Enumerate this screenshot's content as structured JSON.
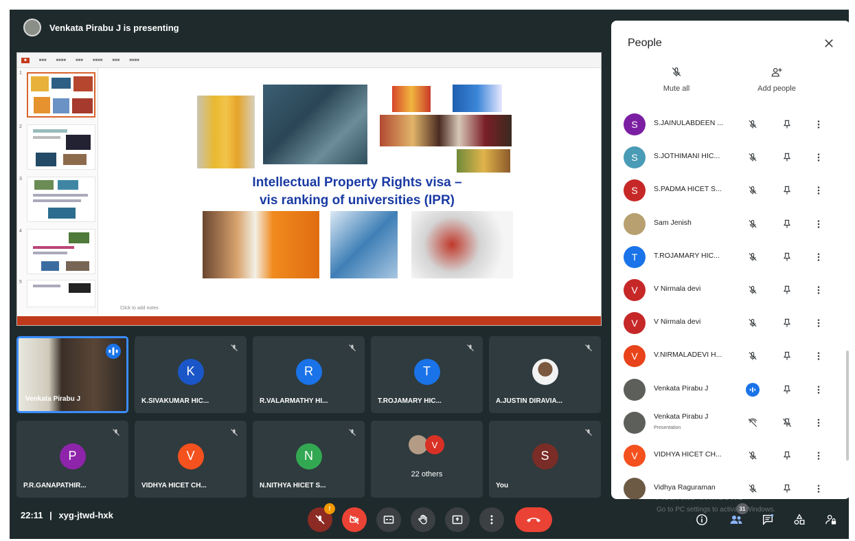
{
  "presenter": {
    "label": "Venkata Pirabu J is presenting"
  },
  "slide": {
    "title_line1": "Intellectual Property Rights visa –",
    "title_line2": "vis ranking of universities  (IPR)",
    "notes_placeholder": "Click to add notes"
  },
  "tiles": [
    {
      "name": "Venkata Pirabu J",
      "initial": "",
      "color": "#3b4a4d",
      "muted": false,
      "speaking": true
    },
    {
      "name": "K.SIVAKUMAR HIC...",
      "initial": "K",
      "color": "#1a56c8",
      "muted": true
    },
    {
      "name": "R.VALARMATHY HI...",
      "initial": "R",
      "color": "#1a73e8",
      "muted": true
    },
    {
      "name": "T.ROJAMARY HIC...",
      "initial": "T",
      "color": "#1a73e8",
      "muted": true
    },
    {
      "name": "A.JUSTIN DIRAVIA...",
      "initial": "",
      "color": "#cfcfcf",
      "muted": true
    },
    {
      "name": "P.R.GANAPATHIR...",
      "initial": "P",
      "color": "#8e24aa",
      "muted": true
    },
    {
      "name": "VIDHYA HICET CH...",
      "initial": "V",
      "color": "#f4511e",
      "muted": true
    },
    {
      "name": "N.NITHYA HICET S...",
      "initial": "N",
      "color": "#33a852",
      "muted": true
    },
    {
      "name": "22 others",
      "initial": "V",
      "color": "#d93025",
      "muted": false
    },
    {
      "name": "You",
      "initial": "S",
      "color": "#7a2c26",
      "muted": true
    }
  ],
  "meeting": {
    "time": "22:11",
    "separator": "|",
    "code": "xyg-jtwd-hxk"
  },
  "controls": {
    "mic_badge": "!",
    "participants_count": "31"
  },
  "watermark": {
    "line1": "Activate Windows",
    "line2": "Go to PC settings to activate Windows."
  },
  "people_panel": {
    "title": "People",
    "mute_all": "Mute all",
    "add_people": "Add people",
    "participants": [
      {
        "name": "S.JAINULABDEEN ...",
        "initial": "S",
        "color": "#7b1fa2",
        "sub": ""
      },
      {
        "name": "S.JOTHIMANI HIC...",
        "initial": "S",
        "color": "#4a9bb5",
        "sub": ""
      },
      {
        "name": "S.PADMA HICET S...",
        "initial": "S",
        "color": "#c62828",
        "sub": ""
      },
      {
        "name": "Sam Jenish",
        "initial": "",
        "color": "#b8a070",
        "sub": ""
      },
      {
        "name": "T.ROJAMARY HIC...",
        "initial": "T",
        "color": "#1a73e8",
        "sub": ""
      },
      {
        "name": "V Nirmala devi",
        "initial": "V",
        "color": "#c62828",
        "sub": ""
      },
      {
        "name": "V Nirmala devi",
        "initial": "V",
        "color": "#c62828",
        "sub": ""
      },
      {
        "name": "V.NIRMALADEVI H...",
        "initial": "V",
        "color": "#e8431a",
        "sub": ""
      },
      {
        "name": "Venkata Pirabu J",
        "initial": "",
        "color": "#5d5f5a",
        "sub": ""
      },
      {
        "name": "Venkata Pirabu J",
        "initial": "",
        "color": "#5d5f5a",
        "sub": "Presentation"
      },
      {
        "name": "VIDHYA HICET CH...",
        "initial": "V",
        "color": "#f4511e",
        "sub": ""
      },
      {
        "name": "Vidhya Raguraman",
        "initial": "",
        "color": "#6d5a44",
        "sub": ""
      }
    ]
  }
}
